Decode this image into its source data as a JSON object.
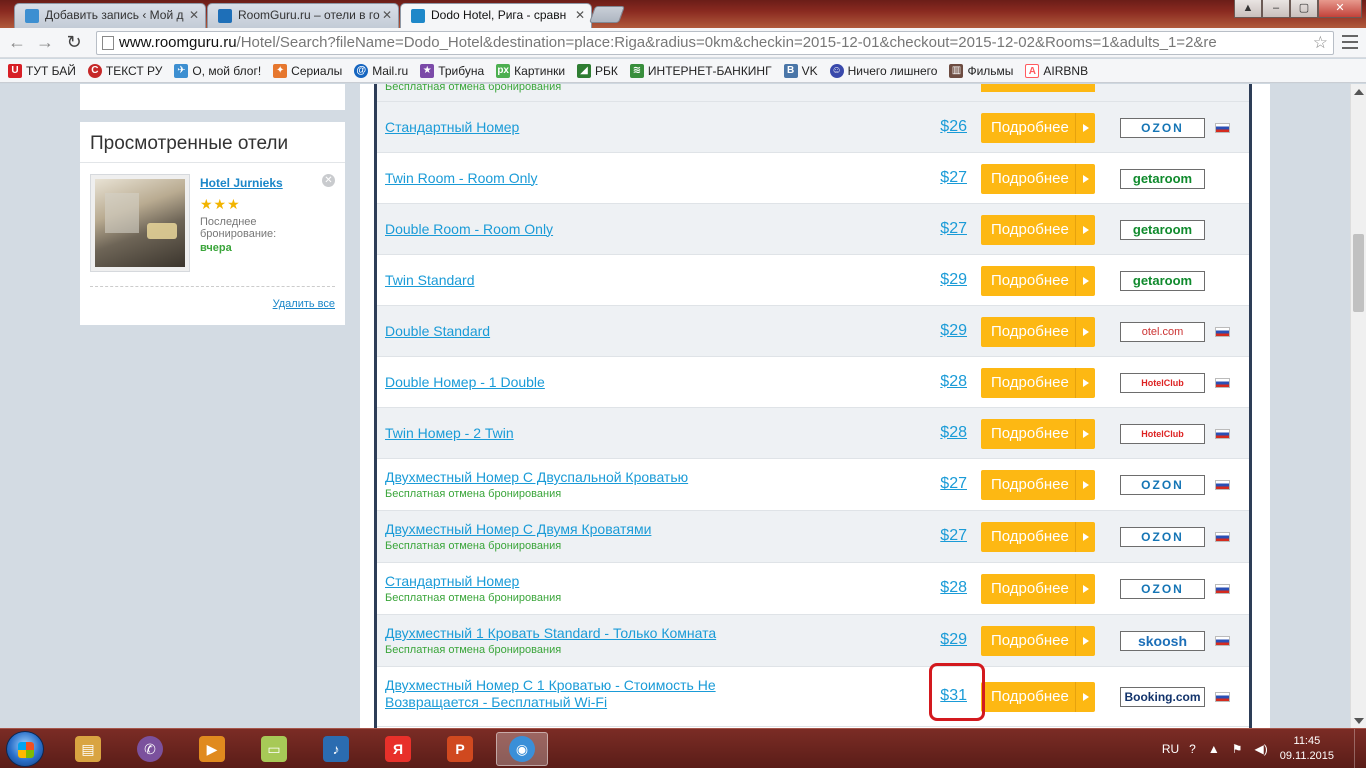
{
  "browser": {
    "tabs": [
      {
        "title": "Добавить запись ‹ Мой д",
        "favicon_color": "#3d8fd1"
      },
      {
        "title": "RoomGuru.ru – отели в го",
        "favicon_color": "#1e6fb8"
      },
      {
        "title": "Dodo Hotel, Рига - сравн",
        "favicon_color": "#1e88c9"
      }
    ],
    "url_host": "www.roomguru.ru",
    "url_path": "/Hotel/Search?fileName=Dodo_Hotel&destination=place:Riga&radius=0km&checkin=2015-12-01&checkout=2015-12-02&Rooms=1&adults_1=2&re",
    "bookmarks": [
      {
        "label": "ТУТ БАЙ",
        "color": "#d71f26"
      },
      {
        "label": "ТЕКСТ РУ",
        "color": "#c62828"
      },
      {
        "label": "О, мой блог!",
        "color": "#3d8fd1"
      },
      {
        "label": "Сериалы",
        "color": "#e6772e"
      },
      {
        "label": "Mail.ru",
        "color": "#1565c0"
      },
      {
        "label": "Трибуна",
        "color": "#7b4aa8"
      },
      {
        "label": "Картинки",
        "color": "#4caf50"
      },
      {
        "label": "РБК",
        "color": "#2e7d32"
      },
      {
        "label": "ИНТЕРНЕТ-БАНКИНГ",
        "color": "#388e3c"
      },
      {
        "label": "VK",
        "color": "#4a76a8"
      },
      {
        "label": "Ничего лишнего",
        "color": "#3949ab"
      },
      {
        "label": "Фильмы",
        "color": "#6d4c41"
      },
      {
        "label": "AIRBNB",
        "color": "#ff5a5f"
      }
    ]
  },
  "sidebar": {
    "title": "Просмотренные отели",
    "hotel": {
      "name": "Hotel Jurnieks",
      "stars": "★★★",
      "last_label": "Последнее бронирование:",
      "when": "вчера"
    },
    "delete_all": "Удалить все"
  },
  "results": {
    "button_label": "Подробнее",
    "rows": [
      {
        "room": "Стандартный Номер",
        "cancel": "",
        "price": "$26",
        "partner": "OZON",
        "partner_class": "ozon",
        "flag": true
      },
      {
        "room": "Twin Room - Room Only",
        "cancel": "",
        "price": "$27",
        "partner": "getaroom",
        "partner_class": "getaroom",
        "flag": false
      },
      {
        "room": "Double Room - Room Only",
        "cancel": "",
        "price": "$27",
        "partner": "getaroom",
        "partner_class": "getaroom",
        "flag": false
      },
      {
        "room": "Twin Standard",
        "cancel": "",
        "price": "$29",
        "partner": "getaroom",
        "partner_class": "getaroom",
        "flag": false
      },
      {
        "room": "Double Standard",
        "cancel": "",
        "price": "$29",
        "partner": "otel.com",
        "partner_class": "otel",
        "flag": true
      },
      {
        "room": "Double Номер - 1 Double",
        "cancel": "",
        "price": "$28",
        "partner": "HotelClub",
        "partner_class": "hotelclub",
        "flag": true
      },
      {
        "room": "Twin Номер - 2 Twin",
        "cancel": "",
        "price": "$28",
        "partner": "HotelClub",
        "partner_class": "hotelclub",
        "flag": true
      },
      {
        "room": "Двухместный Номер С Двуспальной Кроватью",
        "cancel": "Бесплатная отмена бронирования",
        "price": "$27",
        "partner": "OZON",
        "partner_class": "ozon",
        "flag": true
      },
      {
        "room": "Двухместный Номер С Двумя Кроватями",
        "cancel": "Бесплатная отмена бронирования",
        "price": "$27",
        "partner": "OZON",
        "partner_class": "ozon",
        "flag": true
      },
      {
        "room": "Стандартный Номер",
        "cancel": "Бесплатная отмена бронирования",
        "price": "$28",
        "partner": "OZON",
        "partner_class": "ozon",
        "flag": true
      },
      {
        "room": "Двухместный 1 Кровать Standard - Только Комната",
        "cancel": "Бесплатная отмена бронирования",
        "price": "$29",
        "partner": "skoosh",
        "partner_class": "skoosh",
        "flag": true
      },
      {
        "room": "Двухместный Номер С 1 Кроватью - Стоимость Не Возвращается - Бесплатный Wi-Fi",
        "cancel": "",
        "price": "$31",
        "partner": "Booking.com",
        "partner_class": "booking",
        "flag": true
      }
    ],
    "top_partial_cancel": "Бесплатная отмена бронирования"
  },
  "taskbar": {
    "apps": [
      {
        "name": "file-explorer",
        "color": "#d9a441",
        "glyph": "▤"
      },
      {
        "name": "viber",
        "color": "#7b519d",
        "glyph": "✆"
      },
      {
        "name": "media-player",
        "color": "#e08a1e",
        "glyph": "▶"
      },
      {
        "name": "sticky-notes",
        "color": "#a7c957",
        "glyph": "▭"
      },
      {
        "name": "volume",
        "color": "#2b6cb0",
        "glyph": "♪"
      },
      {
        "name": "yandex-browser",
        "color": "#e8302a",
        "glyph": "Я"
      },
      {
        "name": "powerpoint",
        "color": "#d0491f",
        "glyph": "P"
      },
      {
        "name": "chrome",
        "color": "#3a8fd8",
        "glyph": "◉"
      }
    ],
    "lang": "RU",
    "time": "11:45",
    "date": "09.11.2015"
  }
}
